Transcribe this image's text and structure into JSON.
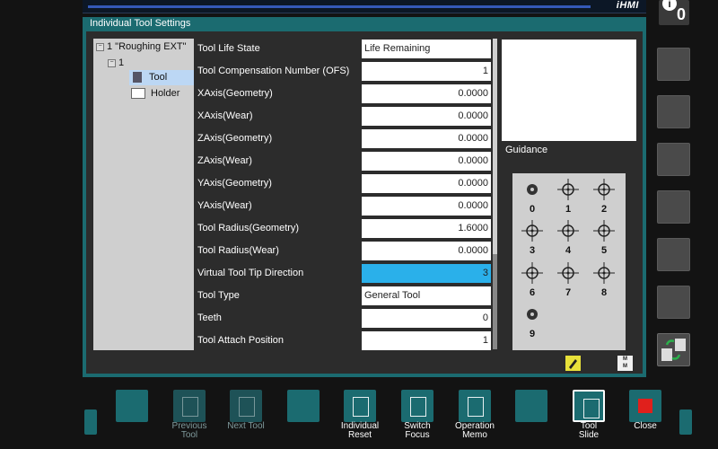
{
  "header": {
    "brand": "iHMI"
  },
  "info_badge": {
    "count": "0"
  },
  "panel": {
    "title": "Individual Tool Settings"
  },
  "tree": {
    "root_label": "1 \"Roughing EXT\"",
    "child_label": "1",
    "items": [
      {
        "label": "Tool",
        "selected": true
      },
      {
        "label": "Holder",
        "selected": false
      }
    ]
  },
  "rows": [
    {
      "label": "Tool Life State",
      "value": "Life Remaining",
      "align": "left"
    },
    {
      "label": "Tool Compensation Number (OFS)",
      "value": "1",
      "align": "right"
    },
    {
      "label": "XAxis(Geometry)",
      "value": "0.0000",
      "align": "right"
    },
    {
      "label": "XAxis(Wear)",
      "value": "0.0000",
      "align": "right"
    },
    {
      "label": "ZAxis(Geometry)",
      "value": "0.0000",
      "align": "right"
    },
    {
      "label": "ZAxis(Wear)",
      "value": "0.0000",
      "align": "right"
    },
    {
      "label": "YAxis(Geometry)",
      "value": "0.0000",
      "align": "right"
    },
    {
      "label": "YAxis(Wear)",
      "value": "0.0000",
      "align": "right"
    },
    {
      "label": "Tool Radius(Geometry)",
      "value": "1.6000",
      "align": "right"
    },
    {
      "label": "Tool Radius(Wear)",
      "value": "0.0000",
      "align": "right"
    },
    {
      "label": "Virtual Tool Tip Direction",
      "value": "3",
      "align": "right",
      "selected": true
    },
    {
      "label": "Tool Type",
      "value": "General Tool",
      "align": "left"
    },
    {
      "label": "Teeth",
      "value": "0",
      "align": "right"
    },
    {
      "label": "Tool Attach Position",
      "value": "1",
      "align": "right"
    }
  ],
  "guidance": {
    "label": "Guidance"
  },
  "tip_directions": [
    "0",
    "1",
    "2",
    "3",
    "4",
    "5",
    "6",
    "7",
    "8",
    "9"
  ],
  "memo_icon_text": "M\nM",
  "softkeys": [
    {
      "label": "",
      "state": "normal"
    },
    {
      "label": "Previous\nTool",
      "state": "dim"
    },
    {
      "label": "Next Tool",
      "state": "dim"
    },
    {
      "label": "",
      "state": "normal"
    },
    {
      "label": "Individual\nReset",
      "state": "normal"
    },
    {
      "label": "Switch\nFocus",
      "state": "normal"
    },
    {
      "label": "Operation\nMemo",
      "state": "normal"
    },
    {
      "label": "",
      "state": "normal"
    },
    {
      "label": "Tool\nSlide",
      "state": "active"
    },
    {
      "label": "Close",
      "state": "normal"
    }
  ],
  "colors": {
    "panel_teal": "#1b6b70",
    "selected_value": "#2ab0ea",
    "close_red": "#e0201c",
    "edit_yellow": "#e8e13a"
  }
}
